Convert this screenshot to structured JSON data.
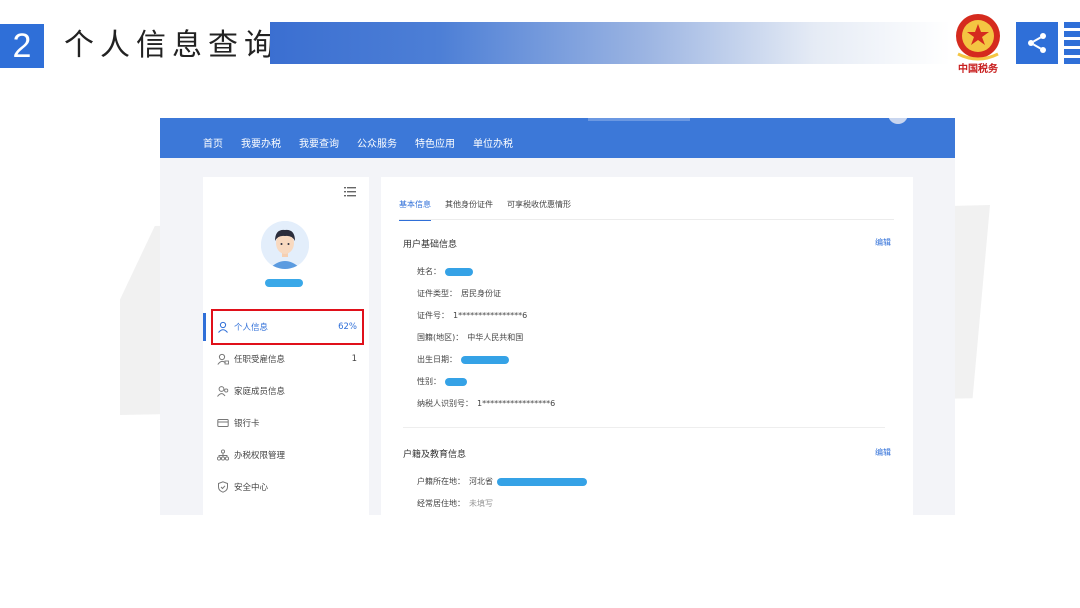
{
  "slide": {
    "number": "2",
    "title": "个人信息查询",
    "emblem_text": "中国税务",
    "accent_color": "#2f6fd8",
    "share_icon": "share-icon"
  },
  "app": {
    "nav": {
      "items": [
        "首页",
        "我要办税",
        "我要查询",
        "公众服务",
        "特色应用",
        "单位办税"
      ],
      "color": "#3c78d8"
    },
    "sidebar": {
      "menu_icon": "list-icon",
      "avatar_icon": "user-avatar-icon",
      "items": [
        {
          "label": "个人信息",
          "badge": "62%",
          "icon": "user-icon",
          "active": true
        },
        {
          "label": "任职受雇信息",
          "badge": "1",
          "icon": "user-briefcase-icon",
          "active": false
        },
        {
          "label": "家庭成员信息",
          "badge": "",
          "icon": "family-icon",
          "active": false
        },
        {
          "label": "银行卡",
          "badge": "",
          "icon": "card-icon",
          "active": false
        },
        {
          "label": "办税权限管理",
          "badge": "",
          "icon": "org-chart-icon",
          "active": false
        },
        {
          "label": "安全中心",
          "badge": "",
          "icon": "shield-icon",
          "active": false
        }
      ]
    },
    "tabs": [
      "基本信息",
      "其他身份证件",
      "可享税收优惠情形"
    ],
    "basic_info": {
      "title": "用户基础信息",
      "edit": "编辑",
      "fields": [
        {
          "label": "姓名：",
          "value": ""
        },
        {
          "label": "证件类型：",
          "value": "居民身份证"
        },
        {
          "label": "证件号：",
          "value": "1****************6"
        },
        {
          "label": "国籍(地区)：",
          "value": "中华人民共和国"
        },
        {
          "label": "出生日期：",
          "value": ""
        },
        {
          "label": "性别：",
          "value": ""
        },
        {
          "label": "纳税人识别号：",
          "value": "1*****************6"
        }
      ]
    },
    "household_info": {
      "title": "户籍及教育信息",
      "edit": "编辑",
      "fields": [
        {
          "label": "户籍所在地：",
          "value": "河北省"
        },
        {
          "label": "经常居住地：",
          "value": "未填写"
        }
      ]
    }
  }
}
